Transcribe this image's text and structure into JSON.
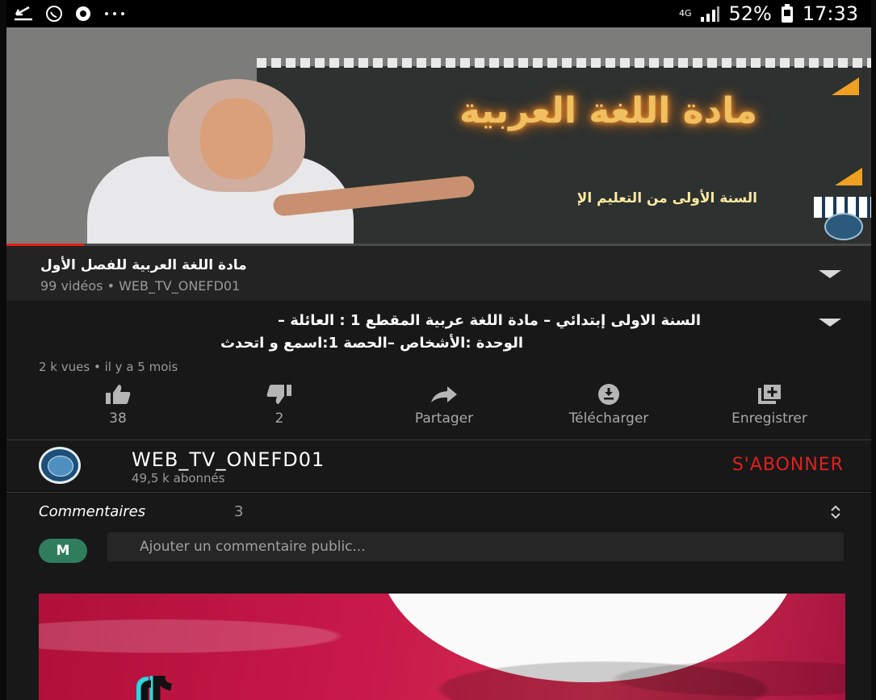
{
  "status_bar": {
    "network": "4G",
    "battery": "52%",
    "time": "17:33",
    "icons": [
      "download-icon",
      "whatsapp-icon",
      "vpn-icon",
      "more-icon",
      "signal-icon",
      "battery-icon"
    ]
  },
  "video": {
    "board_title": "مادة اللغة العربية",
    "board_subtitle": "السنة الأولى من التعليم الإ",
    "progress": 0.09
  },
  "playlist": {
    "title": "مادة اللغة العربية للفصل الأول",
    "meta": "99 vidéos • WEB_TV_ONEFD01"
  },
  "video_info": {
    "title_line1": "السنة الاولى إبتدائي – مادة اللغة عربية المقطع 1 : العائلة –",
    "title_line2": "الوحدة :الأشخاص –الحصة 1:اسمع و اتحدث",
    "meta": "2 k vues • il y a 5 mois",
    "actions": [
      {
        "label": "38",
        "icon": "thumbs-up-icon"
      },
      {
        "label": "2",
        "icon": "thumbs-down-icon"
      },
      {
        "label": "Partager",
        "icon": "share-icon"
      },
      {
        "label": "Télécharger",
        "icon": "download-icon"
      },
      {
        "label": "Enregistrer",
        "icon": "add-to-playlist-icon"
      }
    ]
  },
  "channel": {
    "name": "WEB_TV_ONEFD01",
    "subscribers": "49,5 k abonnés",
    "subscribe_label": "S'ABONNER"
  },
  "comments": {
    "heading": "Commentaires",
    "count": "3",
    "avatar_letter": "M",
    "input_placeholder": "Ajouter un commentaire public..."
  },
  "colors": {
    "accent_red": "#e02020",
    "background": "#181818",
    "avatar_green": "#2f7d5c"
  }
}
